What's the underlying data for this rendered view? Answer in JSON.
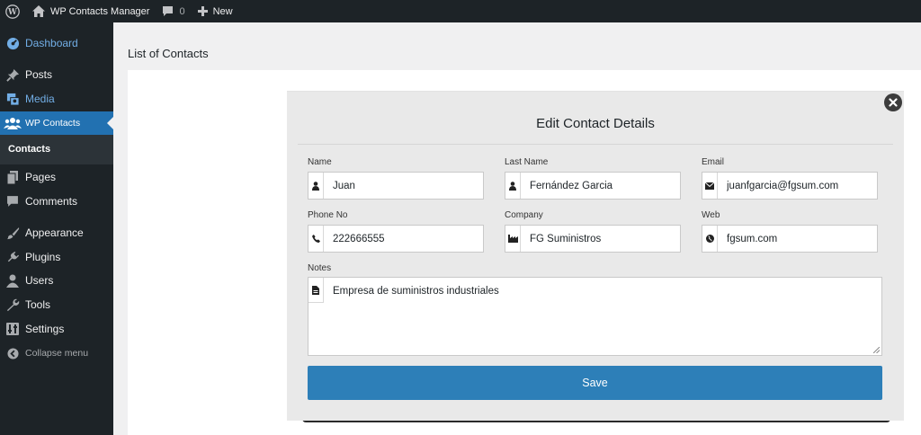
{
  "adminbar": {
    "site_name": "WP Contacts Manager",
    "comments_count": "0",
    "new_label": "New"
  },
  "sidebar": {
    "items": [
      {
        "label": "Dashboard",
        "icon": "dashboard-icon"
      },
      {
        "label": "Posts",
        "icon": "pin-icon"
      },
      {
        "label": "Media",
        "icon": "media-icon"
      },
      {
        "label": "WP Contacts",
        "icon": "users-group-icon"
      },
      {
        "label": "Pages",
        "icon": "pages-icon"
      },
      {
        "label": "Comments",
        "icon": "comment-icon"
      },
      {
        "label": "Appearance",
        "icon": "paintbrush-icon"
      },
      {
        "label": "Plugins",
        "icon": "plugin-icon"
      },
      {
        "label": "Users",
        "icon": "user-icon"
      },
      {
        "label": "Tools",
        "icon": "wrench-icon"
      },
      {
        "label": "Settings",
        "icon": "settings-icon"
      },
      {
        "label": "Collapse menu",
        "icon": "collapse-icon"
      }
    ],
    "submenu": {
      "label": "Contacts"
    }
  },
  "main": {
    "title": "List of Contacts"
  },
  "modal": {
    "title": "Edit Contact Details",
    "fields": {
      "name": {
        "label": "Name",
        "value": "Juan",
        "icon": "user-icon"
      },
      "last_name": {
        "label": "Last Name",
        "value": "Fernández Garcia",
        "icon": "user-icon"
      },
      "email": {
        "label": "Email",
        "value": "juanfgarcia@fgsum.com",
        "icon": "envelope-icon"
      },
      "phone": {
        "label": "Phone No",
        "value": "222666555",
        "icon": "phone-icon"
      },
      "company": {
        "label": "Company",
        "value": "FG Suministros",
        "icon": "industry-icon"
      },
      "web": {
        "label": "Web",
        "value": "fgsum.com",
        "icon": "globe-icon"
      },
      "notes": {
        "label": "Notes",
        "value": "Empresa de suministros industriales",
        "icon": "document-icon"
      }
    },
    "save_label": "Save"
  },
  "colors": {
    "admin_dark": "#1d2327",
    "accent_blue": "#2271b1",
    "save_button": "#2d7fb8",
    "link_blue": "#72aee6"
  }
}
